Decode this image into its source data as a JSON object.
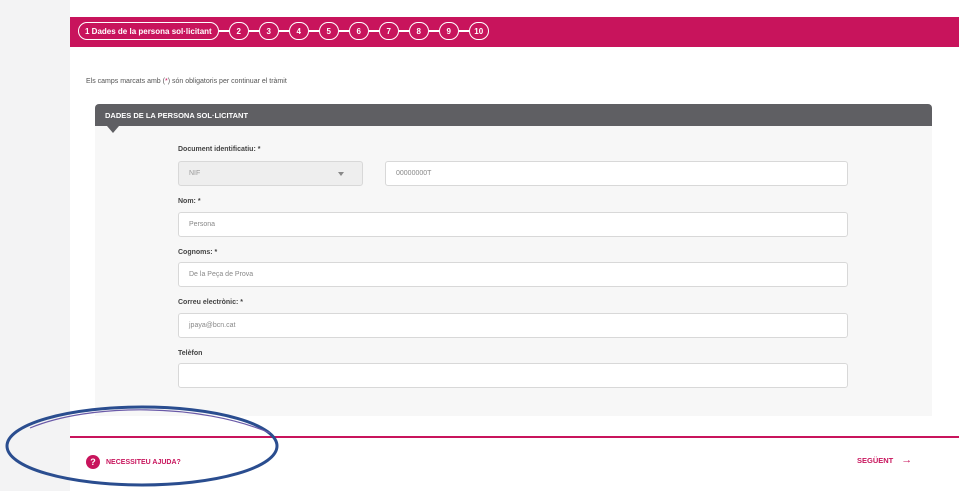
{
  "stepper": {
    "active_label": "1 Dades de la persona sol·licitant",
    "steps": [
      "2",
      "3",
      "4",
      "5",
      "6",
      "7",
      "8",
      "9",
      "10"
    ]
  },
  "required_note": {
    "prefix": "Els camps marcats amb (",
    "star": "*",
    "suffix": ") són obligatoris per continuar el tràmit"
  },
  "section": {
    "title": "DADES DE LA PERSONA SOL·LICITANT"
  },
  "form": {
    "document_label": "Document identificatiu: *",
    "document_type": "NIF",
    "document_number": "00000000T",
    "nom_label": "Nom: *",
    "nom_value": "Persona",
    "cognoms_label": "Cognoms: *",
    "cognoms_value": "De la Peça de Prova",
    "email_label": "Correu electrònic: *",
    "email_value": "jpaya@bcn.cat",
    "phone_label": "Telèfon",
    "phone_value": ""
  },
  "footer": {
    "help_icon": "?",
    "help_label": "NECESSITEU AJUDA?",
    "next_label": "SEGÜENT",
    "next_arrow": "→"
  },
  "colors": {
    "brand": "#c8145c",
    "section": "#5f5f63",
    "annotation": "#2a4d8f"
  }
}
